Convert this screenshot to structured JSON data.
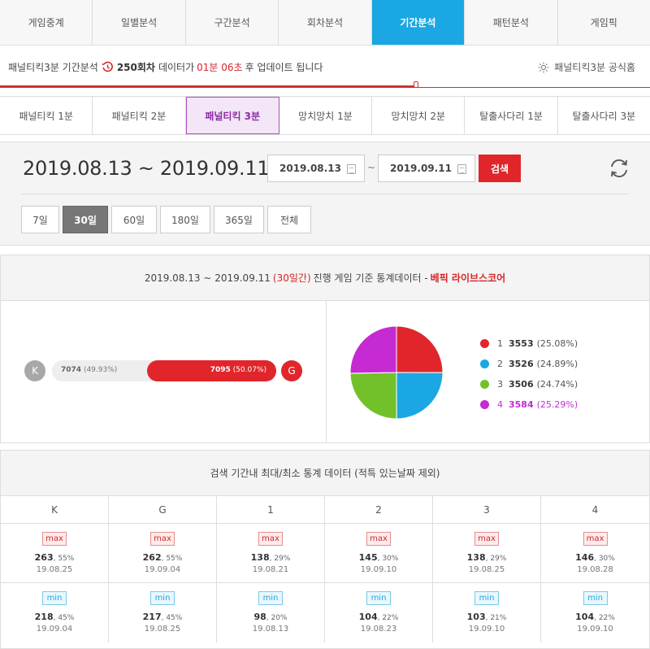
{
  "topnav": {
    "tabs": [
      {
        "label": "게임중계"
      },
      {
        "label": "일별분석"
      },
      {
        "label": "구간분석"
      },
      {
        "label": "회차분석"
      },
      {
        "label": "기간분석"
      },
      {
        "label": "패턴분석"
      },
      {
        "label": "게임픽"
      }
    ],
    "active_index": 4
  },
  "status": {
    "prefix": "패널티킥3분 기간분석",
    "round": "250회차",
    "text1": "데이터가",
    "remaining": "01분 06초",
    "text2": "후 업데이트 됩니다",
    "official_link": "패널티킥3분 공식홈",
    "progress": 0.64
  },
  "game_tabs": {
    "items": [
      {
        "label": "패널티킥 1분"
      },
      {
        "label": "패널티킥 2분"
      },
      {
        "label": "패널티킥 3분"
      },
      {
        "label": "망치망치 1분"
      },
      {
        "label": "망치망치 2분"
      },
      {
        "label": "탈출사다리 1분"
      },
      {
        "label": "탈출사다리 3분"
      }
    ],
    "active_index": 2
  },
  "date_panel": {
    "range_display": "2019.08.13 ~ 2019.09.11",
    "start_date": "2019.08.13",
    "separator": "~",
    "end_date": "2019.09.11",
    "search_label": "검색",
    "periods": [
      {
        "label": "7일"
      },
      {
        "label": "30일"
      },
      {
        "label": "60일"
      },
      {
        "label": "180일"
      },
      {
        "label": "365일"
      },
      {
        "label": "전체"
      }
    ],
    "active_period_index": 1
  },
  "stats": {
    "header_range": "2019.08.13 ~ 2019.09.11",
    "header_days": "(30일간)",
    "header_text": "진행 게임 기준 통계데이터 -",
    "header_brand": "베픽 라이브스코어",
    "k_label": "K",
    "g_label": "G",
    "k_count": "7074",
    "k_pct": "(49.93%)",
    "g_count": "7095",
    "g_pct": "(50.07%)",
    "g_share": 0.5007,
    "colors": {
      "1": "#e0262b",
      "2": "#1aa7e4",
      "3": "#72c12b",
      "4": "#c52ad3"
    },
    "legend": [
      {
        "num": "1",
        "value": "3553",
        "pct": "(25.08%)",
        "color": "#e0262b"
      },
      {
        "num": "2",
        "value": "3526",
        "pct": "(24.89%)",
        "color": "#1aa7e4"
      },
      {
        "num": "3",
        "value": "3506",
        "pct": "(24.74%)",
        "color": "#72c12b"
      },
      {
        "num": "4",
        "value": "3584",
        "pct": "(25.29%)",
        "color": "#c52ad3"
      }
    ]
  },
  "maxmin": {
    "header": "검색 기간내 최대/최소 통계 데이터 (적특 있는날짜 제외)",
    "columns": [
      "K",
      "G",
      "1",
      "2",
      "3",
      "4"
    ],
    "max_label": "max",
    "min_label": "min",
    "max_row": [
      {
        "value": "263",
        "pct": ", 55%",
        "date": "19.08.25"
      },
      {
        "value": "262",
        "pct": ", 55%",
        "date": "19.09.04"
      },
      {
        "value": "138",
        "pct": ", 29%",
        "date": "19.08.21"
      },
      {
        "value": "145",
        "pct": ", 30%",
        "date": "19.09.10"
      },
      {
        "value": "138",
        "pct": ", 29%",
        "date": "19.08.25"
      },
      {
        "value": "146",
        "pct": ", 30%",
        "date": "19.08.28"
      }
    ],
    "min_row": [
      {
        "value": "218",
        "pct": ", 45%",
        "date": "19.09.04"
      },
      {
        "value": "217",
        "pct": ", 45%",
        "date": "19.08.25"
      },
      {
        "value": "98",
        "pct": ", 20%",
        "date": "19.08.13"
      },
      {
        "value": "104",
        "pct": ", 22%",
        "date": "19.08.23"
      },
      {
        "value": "103",
        "pct": ", 21%",
        "date": "19.09.10"
      },
      {
        "value": "104",
        "pct": ", 22%",
        "date": "19.09.10"
      }
    ]
  }
}
